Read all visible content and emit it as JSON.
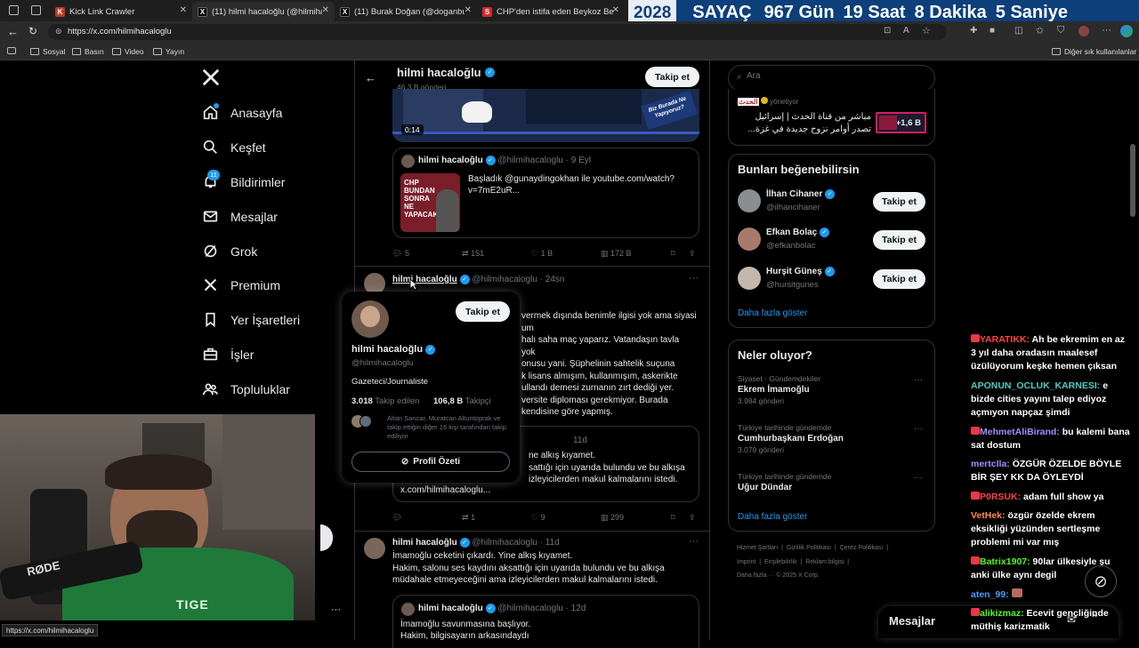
{
  "browser": {
    "tabs": [
      {
        "title": "Kick Link Crawler",
        "favicon": "K"
      },
      {
        "title": "(11) hilmi hacaloğlu (@hilmihacal",
        "favicon": "X"
      },
      {
        "title": "(11) Burak Doğan (@doganburak",
        "favicon": "X"
      },
      {
        "title": "CHP'den istifa eden Beykoz Beled",
        "favicon": "S"
      }
    ],
    "url": "https://x.com/hilmihacaloglu",
    "bookmarks": [
      "Sosyal",
      "Basın",
      "Video",
      "Yayın"
    ],
    "other_bookmarks": "Diğer sık kullanılanlar",
    "status_url": "https://x.com/hilmihacaloglu"
  },
  "countdown": {
    "year": "2028",
    "label": "SAYAÇ",
    "days": "967 Gün",
    "hours": "19 Saat",
    "minutes": "8 Dakika",
    "seconds": "5 Saniye"
  },
  "sidebar": {
    "items": [
      {
        "label": "Anasayfa",
        "icon": "home-icon"
      },
      {
        "label": "Keşfet",
        "icon": "search-icon"
      },
      {
        "label": "Bildirimler",
        "icon": "bell-icon",
        "badge": "11"
      },
      {
        "label": "Mesajlar",
        "icon": "mail-icon"
      },
      {
        "label": "Grok",
        "icon": "grok-icon"
      },
      {
        "label": "Premium",
        "icon": "x-logo-icon"
      },
      {
        "label": "Yer İşaretleri",
        "icon": "bookmark-icon"
      },
      {
        "label": "İşler",
        "icon": "briefcase-icon"
      },
      {
        "label": "Topluluklar",
        "icon": "communities-icon"
      }
    ]
  },
  "profile_header": {
    "name": "hilmi hacaloğlu",
    "posts": "46,3 B gönderi",
    "follow_label": "Takip et"
  },
  "video": {
    "time": "0:14",
    "overlay_text": "Biz Burada Ne Yapıyoruz?"
  },
  "quoted1": {
    "name": "hilmi hacaloğlu",
    "handle": "@hilmihacaloglu",
    "date": "9 Eyl",
    "text": "Başladık @gunaydingokhan ile  youtube.com/watch?v=7mE2uR...",
    "thumb_text": "CHP BUNDAN SONRA NE YAPACAK?"
  },
  "tweet1_actions": {
    "replies": "5",
    "retweets": "151",
    "likes": "1 B",
    "views": "172 B"
  },
  "tweet2": {
    "name": "hilmi hacaloğlu",
    "handle": "@hilmihacaloglu",
    "time": "24sn",
    "lines": [
      "vermek dışında benimle ilgisi yok ama siyasi",
      "um",
      "halı saha maç yaparız. Vatandaşın tavla",
      "yok",
      "onusu yani. Şüphelinin sahtelik suçuna",
      "k lisans almışım, kullanmışım, askerikte",
      "ullandı demesi zurnanın zırt dediği yer.",
      "versite diploması gerekmiyor. Burada",
      "kendisine göre yapmış."
    ],
    "quoted_date": "11d",
    "quoted_lines": [
      "ne alkış kıyamet.",
      "sattığı için uyarıda bulundu ve bu alkışa",
      "izleyicilerden makul kalmalarını istedi."
    ],
    "quoted_link": "x.com/hilmihacaloglu...",
    "actions": {
      "replies": "",
      "retweets": "1",
      "likes": "9",
      "views": "299"
    }
  },
  "tweet3": {
    "name": "hilmi hacaloğlu",
    "handle": "@hilmihacaloglu",
    "time": "11d",
    "lines": [
      "İmamoğlu ceketini çıkardı. Yine alkış kıyamet.",
      "Hakim, salonu ses kaydını aksattığı için uyarıda bulundu ve bu alkışa",
      "müdahale etmeyeceğini ama izleyicilerden makul kalmalarını istedi."
    ],
    "quoted_name": "hilmi hacaloğlu",
    "quoted_handle": "@hilmihacaloglu",
    "quoted_date": "12d",
    "quoted_lines": [
      "İmamoğlu savunmasına başlıyor.",
      "Hakim, bilgisayarın arkasındaydı"
    ]
  },
  "hovercard": {
    "name": "hilmi hacaloğlu",
    "handle": "@hilmihacaloglu",
    "bio": "Gazeteci/Journaliste",
    "following_count": "3.018",
    "following_label": "Takip edilen",
    "followers_count": "106,8 B",
    "followers_label": "Takipçi",
    "followed_by": "Altan Sancar, Muratcan Altuntoprak ve takip ettiğin diğer 16 kişi tarafından takip ediliyor",
    "follow_label": "Takip et",
    "summary_label": "Profil Özeti"
  },
  "search": {
    "placeholder": "Ara"
  },
  "ad": {
    "account": "الحدث",
    "role": "yönetiyor",
    "text_line1": "مباشر من قناة الحدث | إسرائيل",
    "text_line2": "تصدر أوامر نزوح جديدة في غزة...",
    "count": "+1,6 B"
  },
  "suggestions": {
    "title": "Bunları beğenebilirsin",
    "items": [
      {
        "name": "İlhan Cihaner",
        "handle": "@ilhancihaner"
      },
      {
        "name": "Efkan Bolaç",
        "handle": "@efkanbolac"
      },
      {
        "name": "Hurşit Güneş",
        "handle": "@hursitgunes"
      }
    ],
    "follow_label": "Takip et",
    "more": "Daha fazla göster"
  },
  "trends": {
    "title": "Neler oluyor?",
    "items": [
      {
        "context": "Siyaset · Gündemdekiler",
        "name": "Ekrem İmamoğlu",
        "count": "3.984 gönderi"
      },
      {
        "context": "Türkiye tarihinde gündemde",
        "name": "Cumhurbaşkanı Erdoğan",
        "count": "3.070 gönderi"
      },
      {
        "context": "Türkiye tarihinde gündemde",
        "name": "Uğur Dündar",
        "count": ""
      }
    ],
    "more": "Daha fazla göster"
  },
  "footer_links": {
    "line1": [
      "Hizmet Şartları",
      "Gizlilik Politikası",
      "Çerez Politikası"
    ],
    "line2": [
      "Imprint",
      "Erişilebilirlik",
      "Reklam bilgisi"
    ],
    "line3": "Daha fazla ···  © 2025 X Corp."
  },
  "messages_bar": {
    "label": "Mesajlar"
  },
  "chat": [
    {
      "user": "YARATIKK:",
      "user_color": "#ff4444",
      "text": "Ah be ekremim en az 3 yıl daha oradasın maalesef üzülüyorum keşke hemen çıksan",
      "lines": 3
    },
    {
      "user": "APONUN_OCLUK_KARNESI:",
      "user_color": "#4ecdc4",
      "text": "e bizde cities yayını talep ediyoz açmıyon napçaz şimdi",
      "lines": 3
    },
    {
      "user": "MehmetAliBirand:",
      "user_color": "#a78bfa",
      "text": "bu kalemi bana sat dostum",
      "lines": 2
    },
    {
      "user": "mertcIla:",
      "user_color": "#a78bfa",
      "text": "ÖZGÜR ÖZELDE BÖYLE BİR ŞEY KK DA ÖYLEYDİ",
      "lines": 2
    },
    {
      "user": "P0RSUK:",
      "user_color": "#ff4444",
      "text": "adam full show ya",
      "lines": 1
    },
    {
      "user": "VetHek:",
      "user_color": "#ff8c42",
      "text": "özgür özelde ekrem eksikliği yüzünden sertleşme problemi mi var mış",
      "lines": 3
    },
    {
      "user": "Batrix1907:",
      "user_color": "#53fc18",
      "text": "90lar ülkesiyle şu anki ülke aynı degil",
      "lines": 2
    },
    {
      "user": "aten_99:",
      "user_color": "#4e9cff",
      "text": "",
      "lines": 1
    },
    {
      "user": "alikizmaz:",
      "user_color": "#53fc18",
      "text": "Ecevit gençliğinde müthiş karizmatik",
      "lines": 2
    }
  ],
  "webcam": {
    "mic_brand": "RØDE",
    "shirt_text": "TIGE"
  }
}
